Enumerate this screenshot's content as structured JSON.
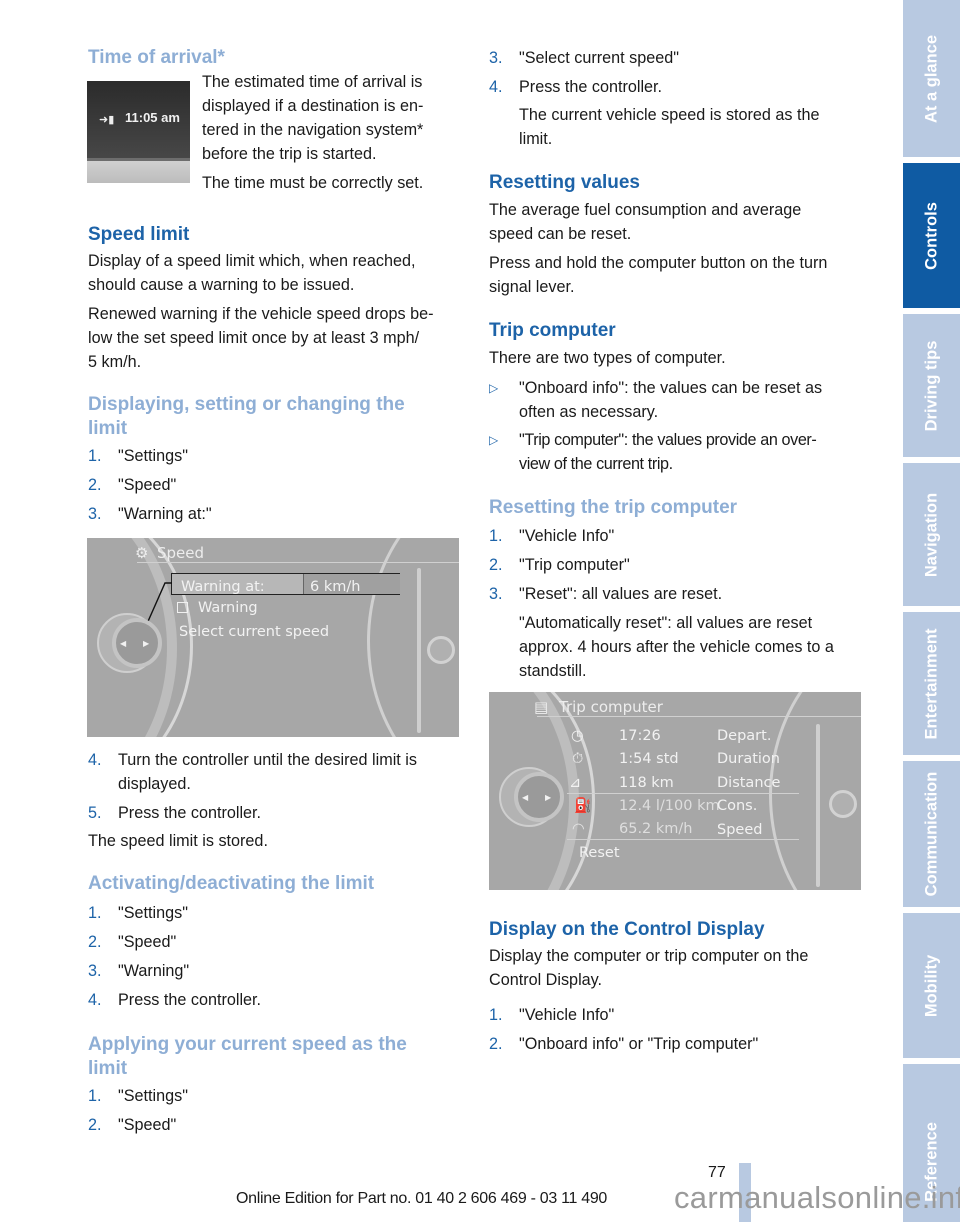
{
  "left": {
    "time_of_arrival": {
      "heading": "Time of arrival*",
      "screen_time": "11:05 am",
      "para1": [
        "The estimated time of arrival is",
        "displayed if a destination is en-",
        "tered in the navigation system*",
        "before the trip is started."
      ],
      "para2": "The time must be correctly set."
    },
    "speed_limit": {
      "heading": "Speed limit",
      "para1": [
        "Display of a speed limit which, when reached,",
        "should cause a warning to be issued."
      ],
      "para2": [
        "Renewed warning if the vehicle speed drops be-",
        "low the set speed limit once by at least 3 mph/",
        "5 km/h."
      ]
    },
    "displaying": {
      "heading": [
        "Displaying, setting or changing the",
        "limit"
      ],
      "steps": [
        {
          "num": "1.",
          "text": "\"Settings\""
        },
        {
          "num": "2.",
          "text": "\"Speed\""
        },
        {
          "num": "3.",
          "text": "\"Warning at:\""
        }
      ],
      "steps_after": [
        {
          "num": "4.",
          "text": [
            "Turn the controller until the desired limit is",
            "displayed."
          ]
        },
        {
          "num": "5.",
          "text": [
            "Press the controller."
          ]
        }
      ],
      "note": "The speed limit is stored."
    },
    "speed_screen": {
      "title": "Speed",
      "rows": [
        "Warning at:",
        "Warning",
        "Select current speed"
      ],
      "value": "6 km/h"
    },
    "activating": {
      "heading": "Activating/deactivating the limit",
      "steps": [
        {
          "num": "1.",
          "text": "\"Settings\""
        },
        {
          "num": "2.",
          "text": "\"Speed\""
        },
        {
          "num": "3.",
          "text": "\"Warning\""
        },
        {
          "num": "4.",
          "text": "Press the controller."
        }
      ]
    },
    "applying": {
      "heading": [
        "Applying your current speed as the",
        "limit"
      ],
      "steps": [
        {
          "num": "1.",
          "text": "\"Settings\""
        },
        {
          "num": "2.",
          "text": "\"Speed\""
        }
      ]
    }
  },
  "right": {
    "applying_cont": {
      "steps": [
        {
          "num": "3.",
          "text": "\"Select current speed\""
        },
        {
          "num": "4.",
          "text": "Press the controller."
        }
      ],
      "note": [
        "The current vehicle speed is stored as the",
        "limit."
      ]
    },
    "resetting_values": {
      "heading": "Resetting values",
      "para1": [
        "The average fuel consumption and average",
        "speed can be reset."
      ],
      "para2": [
        "Press and hold the computer button on the turn",
        "signal lever."
      ]
    },
    "trip_computer": {
      "heading": "Trip computer",
      "intro": "There are two types of computer.",
      "bullets": [
        {
          "symbol": "▷",
          "text": [
            "\"Onboard info\": the values can be reset as",
            "often as necessary."
          ]
        },
        {
          "symbol": "▷",
          "text": [
            "\"Trip computer\": the values provide an over-",
            "view of the current trip."
          ]
        }
      ]
    },
    "resetting_trip": {
      "heading": "Resetting the trip computer",
      "steps": [
        {
          "num": "1.",
          "text": "\"Vehicle Info\""
        },
        {
          "num": "2.",
          "text": "\"Trip computer\""
        },
        {
          "num": "3.",
          "text": "\"Reset\": all values are reset."
        }
      ],
      "note": [
        "\"Automatically reset\": all values are reset",
        "approx. 4 hours after the vehicle comes to a",
        "standstill."
      ]
    },
    "trip_screen": {
      "title": "Trip computer",
      "rows": [
        {
          "icon": "departure-clock-icon",
          "value": "17:26",
          "label": "Depart."
        },
        {
          "icon": "stopwatch-icon",
          "value": "1:54 std",
          "label": "Duration"
        },
        {
          "icon": "road-distance-icon",
          "value": "118 km",
          "label": "Distance"
        },
        {
          "icon": "fuel-pump-icon",
          "value": "12.4 l/100 km",
          "label": "Cons."
        },
        {
          "icon": "speedometer-icon",
          "value": "65.2 km/h",
          "label": "Speed"
        }
      ],
      "reset": "Reset"
    },
    "display_control": {
      "heading": "Display on the Control Display",
      "para": [
        "Display the computer or trip computer on the",
        "Control Display."
      ],
      "steps": [
        {
          "num": "1.",
          "text": "\"Vehicle Info\""
        },
        {
          "num": "2.",
          "text": "\"Onboard info\" or \"Trip computer\""
        }
      ]
    }
  },
  "sidebar": {
    "tabs": [
      {
        "label": "At a glance",
        "active": false
      },
      {
        "label": "Controls",
        "active": true
      },
      {
        "label": "Driving tips",
        "active": false
      },
      {
        "label": "Navigation",
        "active": false
      },
      {
        "label": "Entertainment",
        "active": false
      },
      {
        "label": "Communication",
        "active": false
      },
      {
        "label": "Mobility",
        "active": false
      },
      {
        "label": "Reference",
        "active": false
      }
    ],
    "colors": {
      "active": "#0f5ba3",
      "inactive": "#b8c9e1"
    }
  },
  "footer": {
    "page_number": "77",
    "edition": "Online Edition for Part no. 01 40 2 606 469 - 03 11 490",
    "watermark": "carmanualsonline.info"
  }
}
